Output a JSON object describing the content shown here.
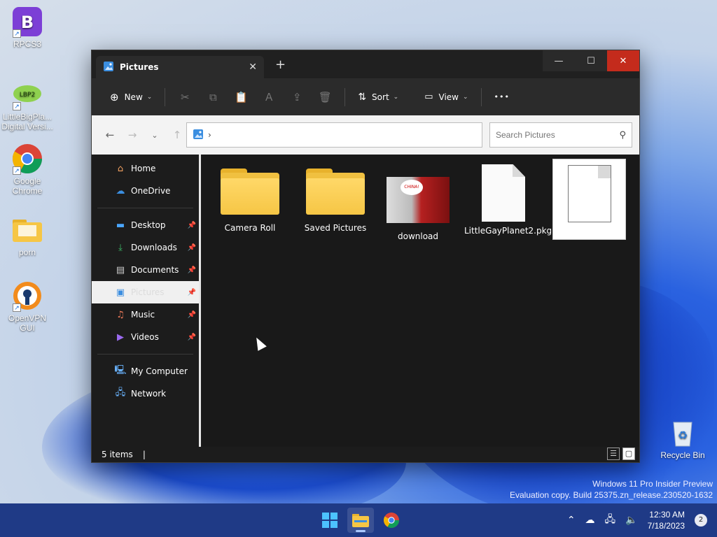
{
  "desktop": {
    "icons": [
      {
        "label": "RPCS3"
      },
      {
        "label": "LittleBigPla... Digital Versi..."
      },
      {
        "label": "Google Chrome"
      },
      {
        "label": "porn"
      },
      {
        "label": "OpenVPN GUI"
      },
      {
        "label": "Recycle Bin"
      }
    ]
  },
  "window": {
    "tab_title": "Pictures",
    "new_tab": "+",
    "toolbar": {
      "new_label": "New",
      "sort_label": "Sort",
      "view_label": "View",
      "more_label": "•••"
    },
    "address": {
      "path_separator": "›"
    },
    "search": {
      "placeholder": "Search Pictures"
    },
    "sidebar": {
      "items": [
        {
          "label": "Home"
        },
        {
          "label": "OneDrive"
        },
        {
          "label": "Desktop"
        },
        {
          "label": "Downloads"
        },
        {
          "label": "Documents"
        },
        {
          "label": "Pictures"
        },
        {
          "label": "Music"
        },
        {
          "label": "Videos"
        },
        {
          "label": "My Computer"
        },
        {
          "label": "Network"
        }
      ]
    },
    "files": [
      {
        "name": "Camera Roll",
        "type": "folder"
      },
      {
        "name": "Saved Pictures",
        "type": "folder"
      },
      {
        "name": "download",
        "type": "image"
      },
      {
        "name": "LittleGayPlanet2.pkg",
        "type": "file"
      },
      {
        "name": "",
        "type": "file-selected"
      }
    ],
    "thumb_text": "CHINA!",
    "status": {
      "item_count": "5 items",
      "cursor": "|"
    }
  },
  "watermark": {
    "line1": "Windows 11 Pro Insider Preview",
    "line2": "Evaluation copy. Build 25375.zn_release.230520-1632"
  },
  "taskbar": {
    "time": "12:30 AM",
    "date": "7/18/2023",
    "notifications": "2"
  },
  "colors": {
    "accent": "#1f3a86",
    "close_red": "#c42b1c",
    "folder_yellow": "#f6c645"
  }
}
